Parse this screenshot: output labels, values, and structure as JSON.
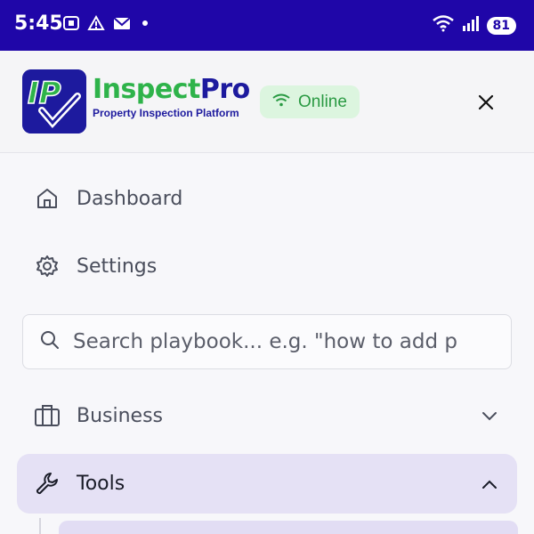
{
  "status_bar": {
    "time": "5:45",
    "battery": "81",
    "icons_left": [
      "screenshot-icon",
      "warning-icon",
      "mail-icon",
      "dot-icon"
    ],
    "icons_right": [
      "wifi-icon",
      "signal-icon",
      "battery-icon"
    ]
  },
  "header": {
    "logo_text": "IP",
    "brand_inspect": "Inspect",
    "brand_pro": "Pro",
    "subtitle": "Property Inspection Platform",
    "online_label": "Online",
    "colors": {
      "brand_blue": "#1d1a9e",
      "brand_green": "#2eb34a",
      "online_bg": "#dcf5df"
    }
  },
  "nav": {
    "dashboard_label": "Dashboard",
    "settings_label": "Settings",
    "search_placeholder": "Search playbook... e.g. \"how to add p",
    "business_label": "Business",
    "tools_label": "Tools"
  },
  "colors": {
    "status_bar": "#1f06a8",
    "active_bg": "#e5e1f5"
  }
}
